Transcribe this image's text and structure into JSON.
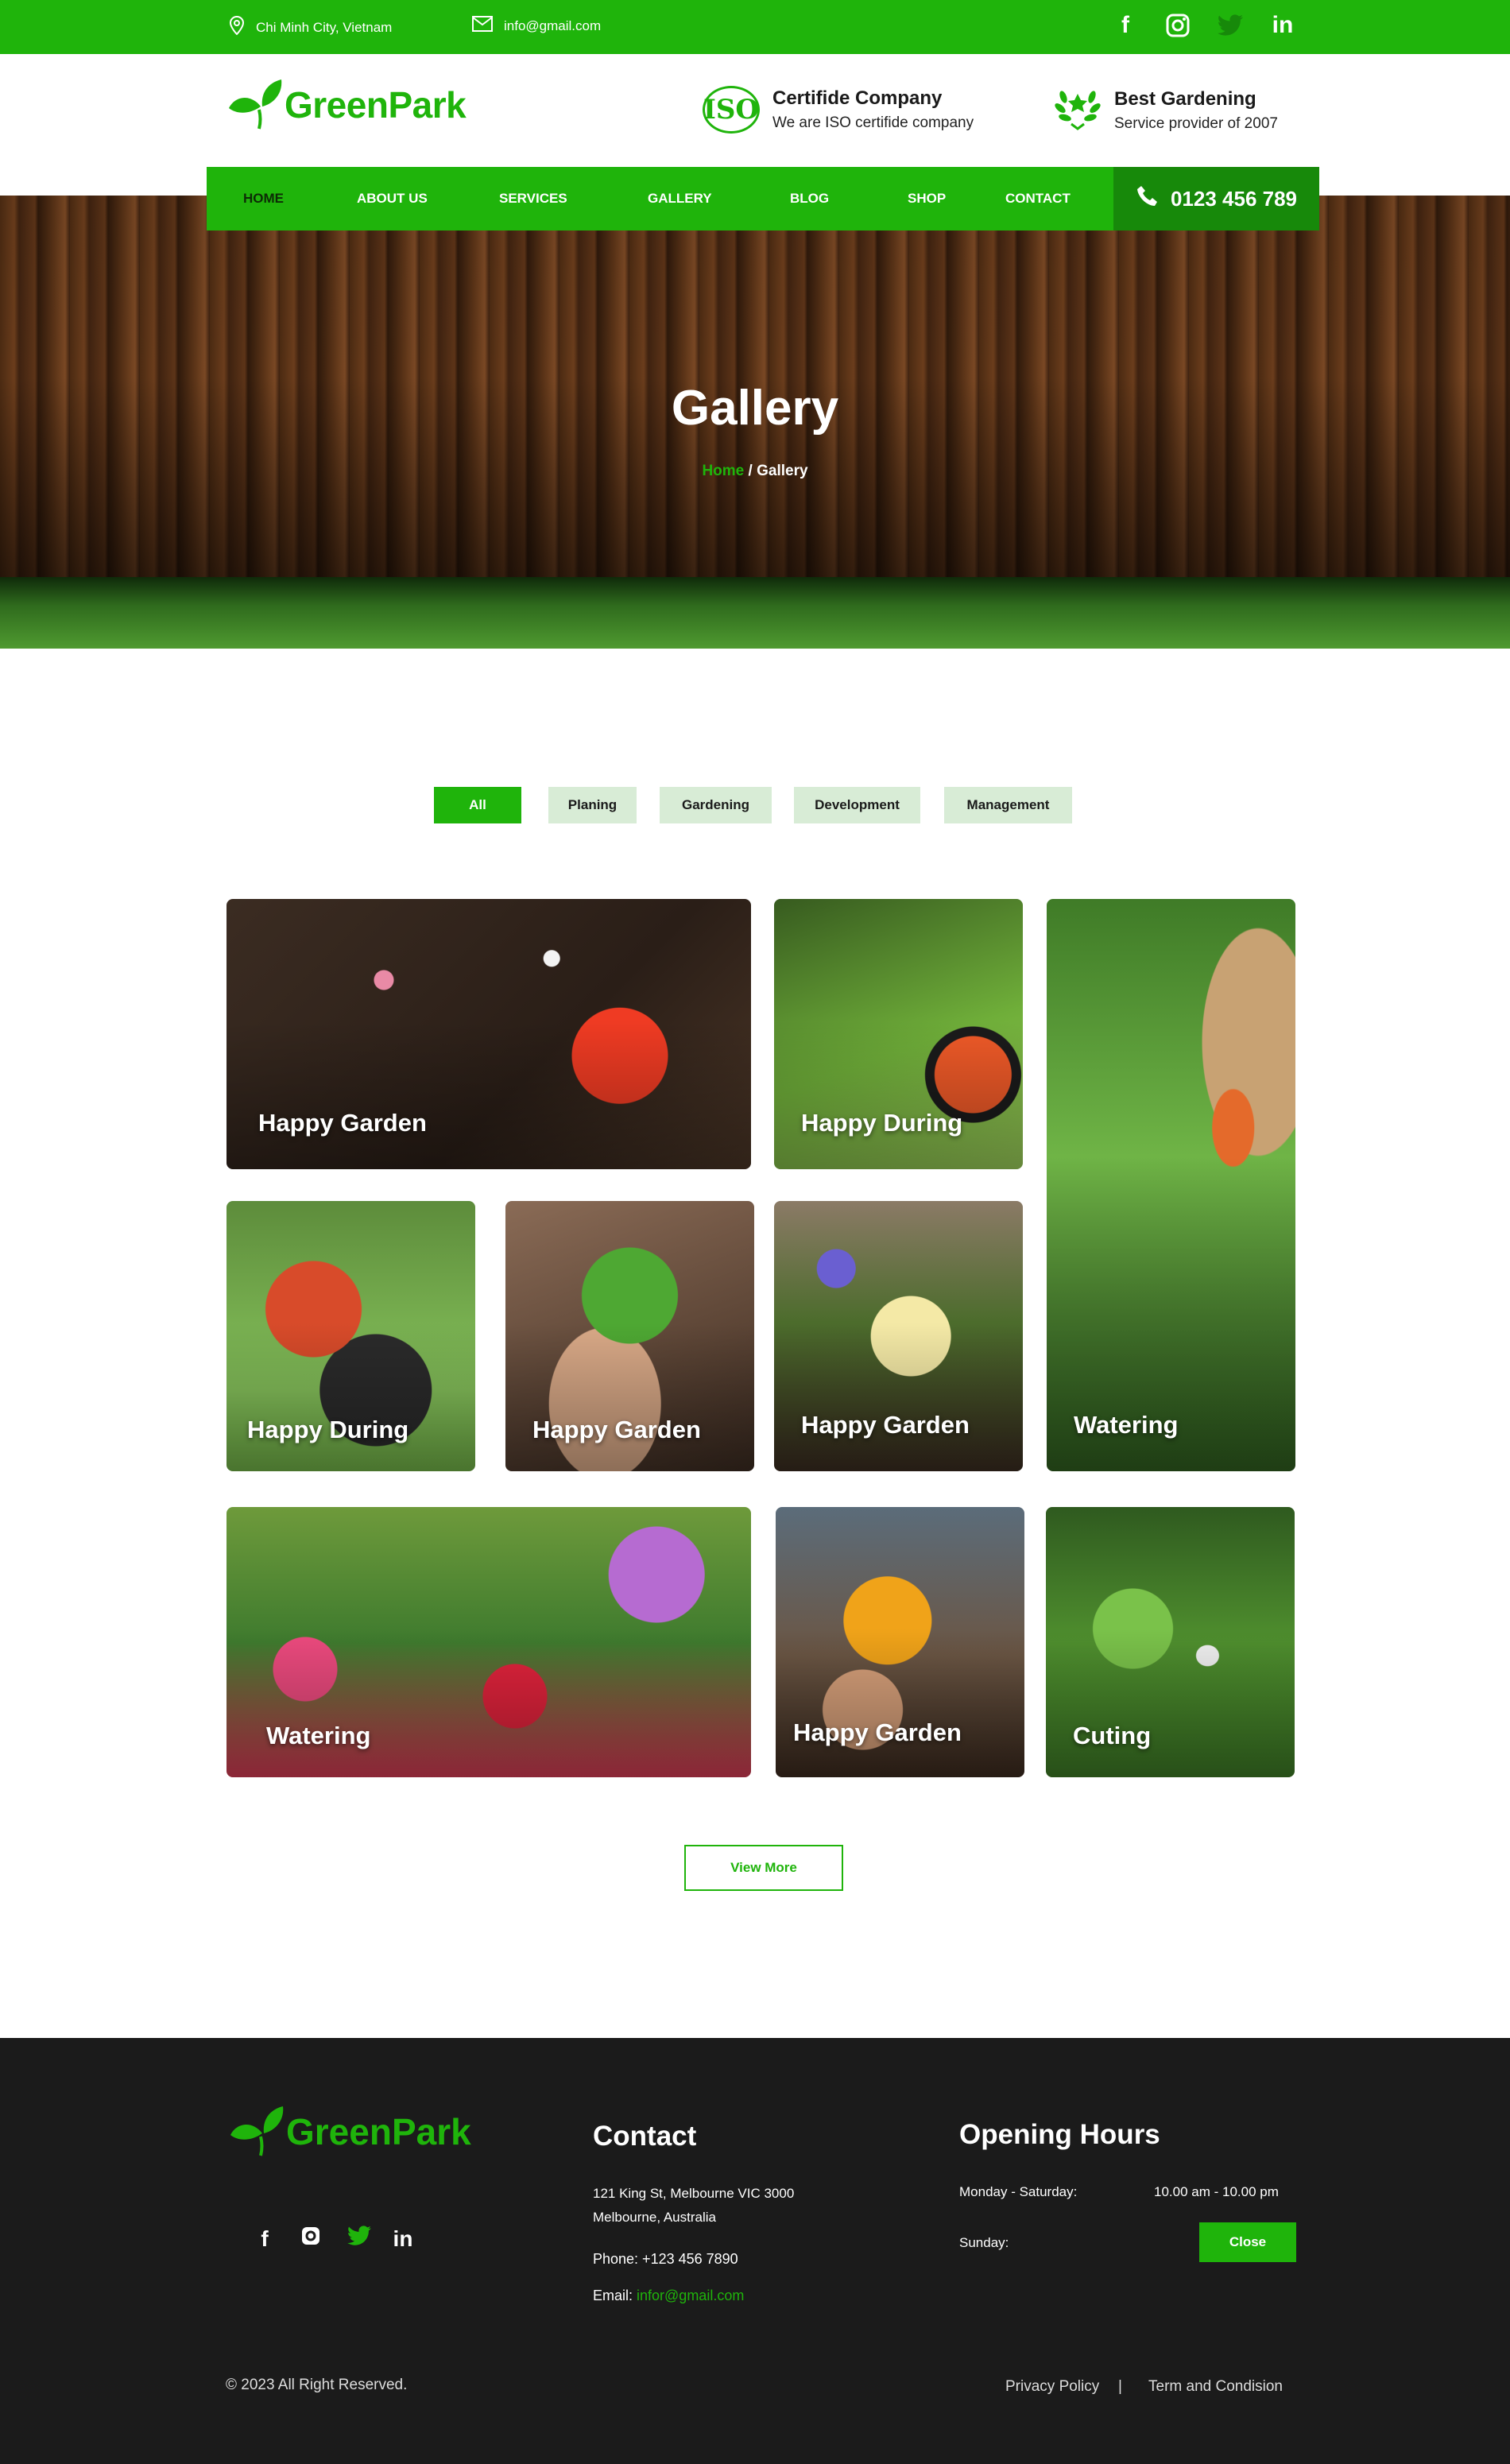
{
  "topbar": {
    "location": "Chi Minh City, Vietnam",
    "email": "info@gmail.com",
    "socials": [
      "facebook-icon",
      "instagram-icon",
      "twitter-icon",
      "linkedin-icon"
    ]
  },
  "brand": {
    "name": "GreenPark",
    "color": "#1fb40b"
  },
  "header": {
    "iso_badge": "ISO",
    "cert_title": "Certifide Company",
    "cert_sub": "We are ISO certifide company",
    "best_title": "Best Gardening",
    "best_sub": "Service provider of 2007"
  },
  "nav": {
    "items": [
      "HOME",
      "ABOUT US",
      "SERVICES",
      "GALLERY",
      "BLOG",
      "SHOP",
      "CONTACT"
    ],
    "active": "HOME",
    "phone": "0123 456 789"
  },
  "hero": {
    "title": "Gallery",
    "crumb_home": "Home",
    "crumb_sep": " / ",
    "crumb_current": "Gallery"
  },
  "filters": {
    "tabs": [
      "All",
      "Planing",
      "Gardening",
      "Development",
      "Management"
    ],
    "active": "All"
  },
  "gallery": {
    "items": [
      {
        "caption": "Happy Garden"
      },
      {
        "caption": "Happy During"
      },
      {
        "caption": "Watering"
      },
      {
        "caption": "Happy During"
      },
      {
        "caption": "Happy Garden"
      },
      {
        "caption": "Happy Garden"
      },
      {
        "caption": "Watering"
      },
      {
        "caption": "Happy Garden"
      },
      {
        "caption": "Cuting"
      }
    ]
  },
  "view_more": "View More",
  "footer": {
    "contact_title": "Contact",
    "address_line1": "121 King St, Melbourne VIC 3000",
    "address_line2": "Melbourne, Australia",
    "phone": "Phone: +123 456 7890",
    "email_label": "Email: ",
    "email_value": "infor@gmail.com",
    "hours_title": "Opening Hours",
    "weekday_label": "Monday - Saturday:",
    "weekday_hours": "10.00 am - 10.00 pm",
    "sunday_label": "Sunday:",
    "sunday_value": "Close",
    "copyright": "© 2023 All Right Reserved.",
    "privacy": "Privacy Policy",
    "legal_sep": "|",
    "terms": "Term and Condision"
  }
}
